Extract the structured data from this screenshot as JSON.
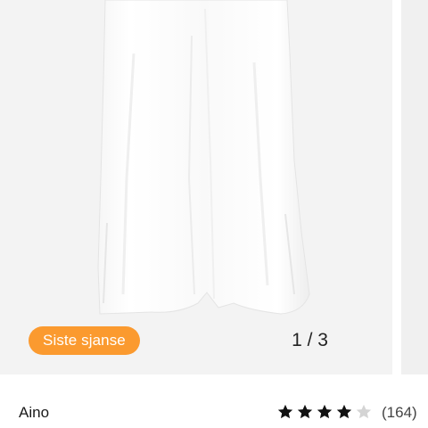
{
  "product": {
    "badge_label": "Siste sjanse",
    "image_counter": "1 / 3",
    "current_image": 1,
    "total_images": 3,
    "brand": "Aino",
    "rating": {
      "stars_filled": 4,
      "stars_total": 5,
      "count_text": "(164)"
    }
  },
  "colors": {
    "badge_bg": "#fb9a2f",
    "star_filled": "#111111",
    "star_empty": "#d4d4d4"
  },
  "icons": {
    "star": "star-icon"
  }
}
